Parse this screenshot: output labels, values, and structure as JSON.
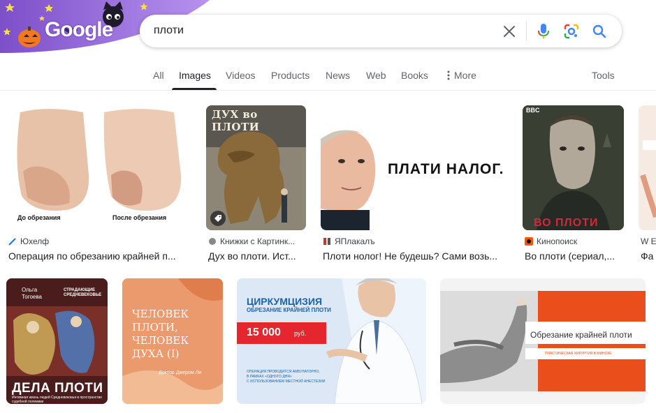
{
  "header": {
    "logo": "Google",
    "search": {
      "value": "плоти"
    }
  },
  "tabs": [
    {
      "label": "All"
    },
    {
      "label": "Images"
    },
    {
      "label": "Videos"
    },
    {
      "label": "Products"
    },
    {
      "label": "News"
    },
    {
      "label": "Web"
    },
    {
      "label": "Books"
    },
    {
      "label": "More"
    }
  ],
  "tools_label": "Tools",
  "results": [
    {
      "source": "Юхелф",
      "title": "Операция по обрезанию крайней п...",
      "captions": [
        "До обрезания",
        "После обрезания"
      ]
    },
    {
      "source": "Книжки с Картинк...",
      "title": "Дух во плоти. Ист...",
      "captions": [
        "ДУХ во ПЛОТИ"
      ]
    },
    {
      "source": "ЯПлакалъ",
      "title": "Плоти нолог! Не будешь? Сами возь...",
      "captions": [
        "ПЛАТИ НАЛОГ."
      ]
    },
    {
      "source": "Кинопоиск",
      "title": "Во плоти (сериал,...",
      "captions": [
        "BBC",
        "ВО ПЛОТИ"
      ]
    },
    {
      "source": "W Е",
      "title": "Фа",
      "captions": []
    },
    {
      "source": "",
      "title": "",
      "captions": [
        "Ольга Тогоева",
        "СТРАДАЮЩИЕ СРЕДНЕВЕКОВЬЕ",
        "ДЕЛА ПЛОТИ",
        "Интимная жизнь людей Средневековья в пространстве судебной полемики"
      ]
    },
    {
      "source": "",
      "title": "",
      "captions": [
        "ЧЕЛОВЕК ПЛОТИ, ЧЕЛОВЕК ДУХА (I)",
        "Доктор Джером Ли"
      ]
    },
    {
      "source": "",
      "title": "",
      "captions": [
        "ЦИРКУМЦИЗИЯ",
        "ОБРЕЗАНИЕ КРАЙНЕЙ ПЛОТИ",
        "15 000",
        "руб.",
        "ОПЕРАЦИЯ ПРОВОДИТСЯ АМБУЛАТОРНО,",
        "В РАМКАХ «ОДНОГО ДНЯ»",
        "С ИСПОЛЬЗОВАНИЕМ МЕСТНОЙ АНЕСТЕЗИИ"
      ]
    },
    {
      "source": "",
      "title": "",
      "captions": [
        "Обрезание крайней плоти",
        "ПЛАСТИЧЕСКАЯ ХИРУРГИЯ В МИНСКЕ"
      ]
    }
  ],
  "colors": {
    "google_blue": "#4285f4",
    "google_red": "#ea4335",
    "google_yellow": "#fbbc05",
    "google_green": "#34a853",
    "doodle_purple": "#a070d8",
    "text_primary": "#202124",
    "text_secondary": "#5f6368"
  },
  "icons": {
    "clear": "close-icon",
    "voice": "mic-icon",
    "lens": "camera-lens-icon",
    "search": "search-icon",
    "more": "vertical-dots-icon",
    "product": "tag-icon"
  }
}
